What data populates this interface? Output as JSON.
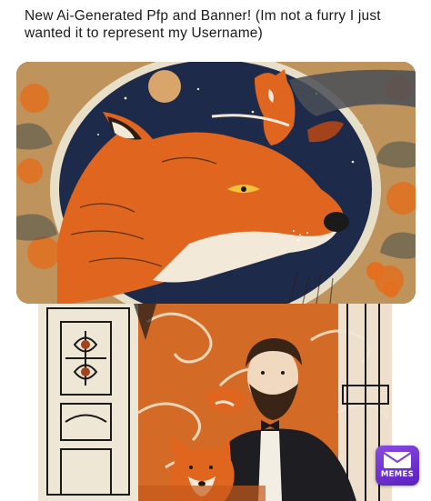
{
  "post": {
    "caption": "New Ai-Generated Pfp and Banner! (Im not a furry I just wanted it to represent my Username)"
  },
  "images": [
    {
      "name": "banner-image",
      "subject": "fox-head-art-nouveau"
    },
    {
      "name": "pfp-image",
      "subject": "bearded-man-with-fox"
    }
  ],
  "watermark": {
    "label": "MEMES",
    "icon": "envelope-icon",
    "color": "#7a3bd8"
  },
  "colors": {
    "fox_orange": "#e0661f",
    "night_navy": "#1e2a4a",
    "moon": "#d9a56a"
  }
}
